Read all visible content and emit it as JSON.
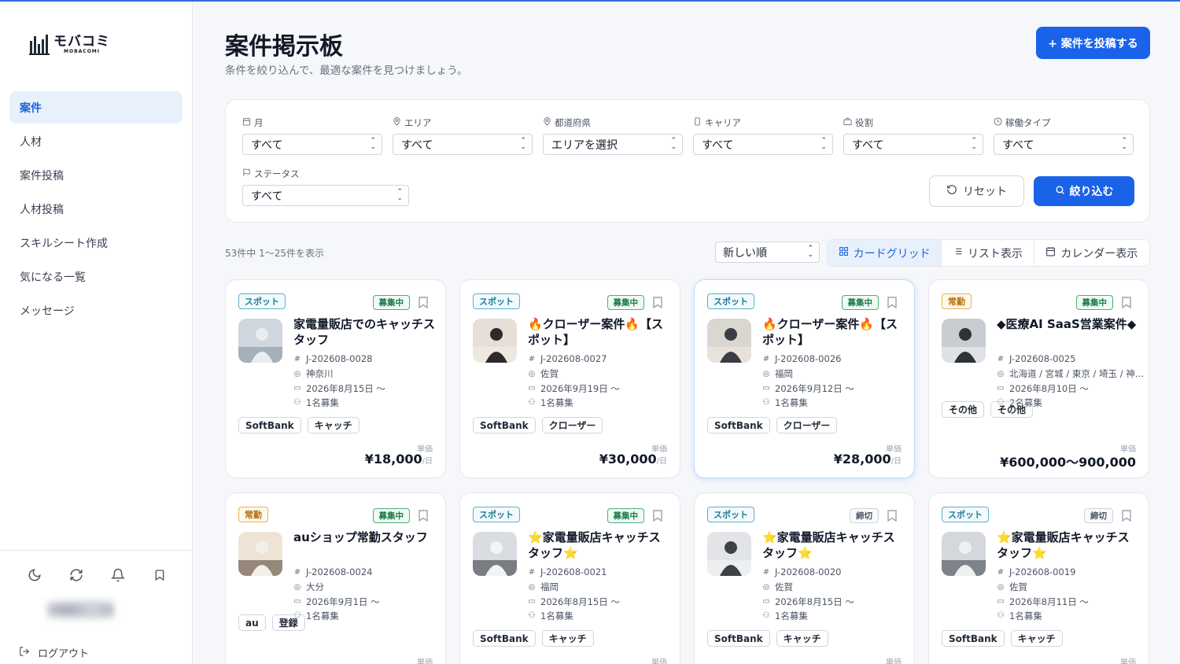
{
  "app": {
    "logo_main": "モバコミ",
    "logo_sub": "MOBACOMI"
  },
  "sidebar": {
    "items": [
      {
        "label": "案件"
      },
      {
        "label": "人材"
      },
      {
        "label": "案件投稿"
      },
      {
        "label": "人材投稿"
      },
      {
        "label": "スキルシート作成"
      },
      {
        "label": "気になる一覧"
      },
      {
        "label": "メッセージ"
      }
    ],
    "logout": "ログアウト"
  },
  "header": {
    "title": "案件掲示板",
    "subtitle": "条件を絞り込んで、最適な案件を見つけましょう。",
    "post_button": "+ 案件を投稿する"
  },
  "filters": {
    "month": {
      "label": "月",
      "value": "すべて"
    },
    "area": {
      "label": "エリア",
      "value": "すべて"
    },
    "prefecture": {
      "label": "都道府県",
      "value": "エリアを選択"
    },
    "carrier": {
      "label": "キャリア",
      "value": "すべて"
    },
    "role": {
      "label": "役割",
      "value": "すべて"
    },
    "work_type": {
      "label": "稼働タイプ",
      "value": "すべて"
    },
    "status": {
      "label": "ステータス",
      "value": "すべて"
    },
    "reset": "リセット",
    "search": "絞り込む"
  },
  "results": {
    "count": "53件中 1〜25件を表示",
    "sort": "新しい順",
    "views": [
      "カードグリッド",
      "リスト表示",
      "カレンダー表示"
    ]
  },
  "price_label": "単価",
  "cards": [
    {
      "type": "スポット",
      "status": "募集中",
      "title": "家電量販店でのキャッチスタッフ",
      "id": "J-202608-0028",
      "location": "神奈川",
      "date": "2026年8月15日 〜",
      "people": "1名募集",
      "tags": [
        "SoftBank",
        "キャッチ"
      ],
      "price": "¥18,000",
      "unit": "/日"
    },
    {
      "type": "スポット",
      "status": "募集中",
      "title": "🔥クローザー案件🔥【スポット】",
      "id": "J-202608-0027",
      "location": "佐賀",
      "date": "2026年9月19日 〜",
      "people": "1名募集",
      "tags": [
        "SoftBank",
        "クローザー"
      ],
      "price": "¥30,000",
      "unit": "/日"
    },
    {
      "type": "スポット",
      "status": "募集中",
      "title": "🔥クローザー案件🔥【スポット】",
      "id": "J-202608-0026",
      "location": "福岡",
      "date": "2026年9月12日 〜",
      "people": "1名募集",
      "tags": [
        "SoftBank",
        "クローザー"
      ],
      "price": "¥28,000",
      "unit": "/日"
    },
    {
      "type": "常勤",
      "status": "募集中",
      "title": "◆医療AI SaaS営業案件◆",
      "id": "J-202608-0025",
      "location": "北海道 / 宮城 / 東京 / 埼玉 / 神…",
      "date": "2026年8月10日 〜",
      "people": "2名募集",
      "tags": [
        "その他",
        "その他"
      ],
      "price": "¥600,000〜900,000",
      "unit": ""
    },
    {
      "type": "常勤",
      "status": "募集中",
      "title": "auショップ常勤スタッフ",
      "id": "J-202608-0024",
      "location": "大分",
      "date": "2026年9月1日 〜",
      "people": "1名募集",
      "tags": [
        "au",
        "登録"
      ],
      "price": "",
      "unit": ""
    },
    {
      "type": "スポット",
      "status": "募集中",
      "title": "⭐家電量販店キャッチスタッフ⭐",
      "id": "J-202608-0021",
      "location": "福岡",
      "date": "2026年8月15日 〜",
      "people": "1名募集",
      "tags": [
        "SoftBank",
        "キャッチ"
      ],
      "price": "",
      "unit": ""
    },
    {
      "type": "スポット",
      "status": "締切",
      "title": "⭐家電量販店キャッチスタッフ⭐",
      "id": "J-202608-0020",
      "location": "佐賀",
      "date": "2026年8月15日 〜",
      "people": "1名募集",
      "tags": [
        "SoftBank",
        "キャッチ"
      ],
      "price": "",
      "unit": ""
    },
    {
      "type": "スポット",
      "status": "締切",
      "title": "⭐家電量販店キャッチスタッフ⭐",
      "id": "J-202608-0019",
      "location": "佐賀",
      "date": "2026年8月11日 〜",
      "people": "1名募集",
      "tags": [
        "SoftBank",
        "キャッチ"
      ],
      "price": "",
      "unit": ""
    }
  ],
  "colors": {
    "accent": "#1a63e8",
    "open": "#1f7a4d",
    "spot": "#1d7a96",
    "regular": "#b46e0c"
  }
}
